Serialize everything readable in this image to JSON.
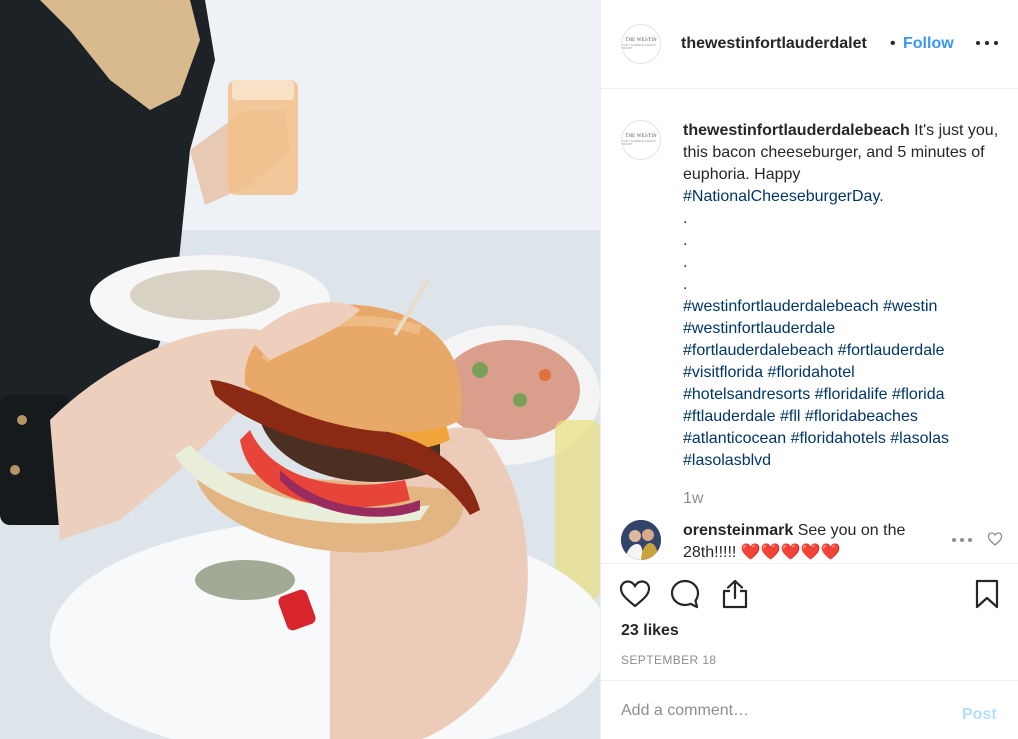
{
  "post": {
    "username_short": "thewestinfortlauderdalet",
    "header_separator": "•",
    "follow_label": "Follow",
    "avatar_logo_word": "THE WESTIN",
    "avatar_logo_sub": "FORT LAUDERDALE BEACH RESORT"
  },
  "caption": {
    "username": "thewestinfortlauderdalebeach",
    "text": "It's just you, this bacon cheeseburger, and 5 minutes of euphoria. Happy",
    "hashtag_main": "#NationalCheeseburgerDay",
    "period": ".",
    "dots": [
      ".",
      ".",
      ".",
      "."
    ],
    "hashtags": [
      "#westinfortlauderdalebeach",
      "#westin",
      "#westinfortlauderdale",
      "#fortlauderdalebeach",
      "#fortlauderdale",
      "#visitflorida",
      "#floridahotel",
      "#hotelsandresorts",
      "#floridalife",
      "#florida",
      "#ftlauderdale",
      "#fll",
      "#floridabeaches",
      "#atlanticocean",
      "#floridahotels",
      "#lasolas",
      "#lasolasblvd"
    ],
    "time_ago": "1w"
  },
  "comment": {
    "username": "orensteinmark",
    "text": "See you on the 28th!!!!! ❤️❤️❤️❤️❤️"
  },
  "actions": {
    "likes": "23 likes",
    "date": "SEPTEMBER 18"
  },
  "add_comment": {
    "placeholder": "Add a comment…",
    "post_label": "Post"
  },
  "colors": {
    "link_blue": "#3897f0",
    "hashtag": "#003569",
    "muted": "#8e8e8e",
    "post_disabled": "#b2dffc"
  },
  "icons": [
    "more-icon",
    "heart-icon",
    "comment-icon",
    "share-icon",
    "bookmark-icon",
    "comment-more-icon",
    "comment-heart-icon"
  ]
}
